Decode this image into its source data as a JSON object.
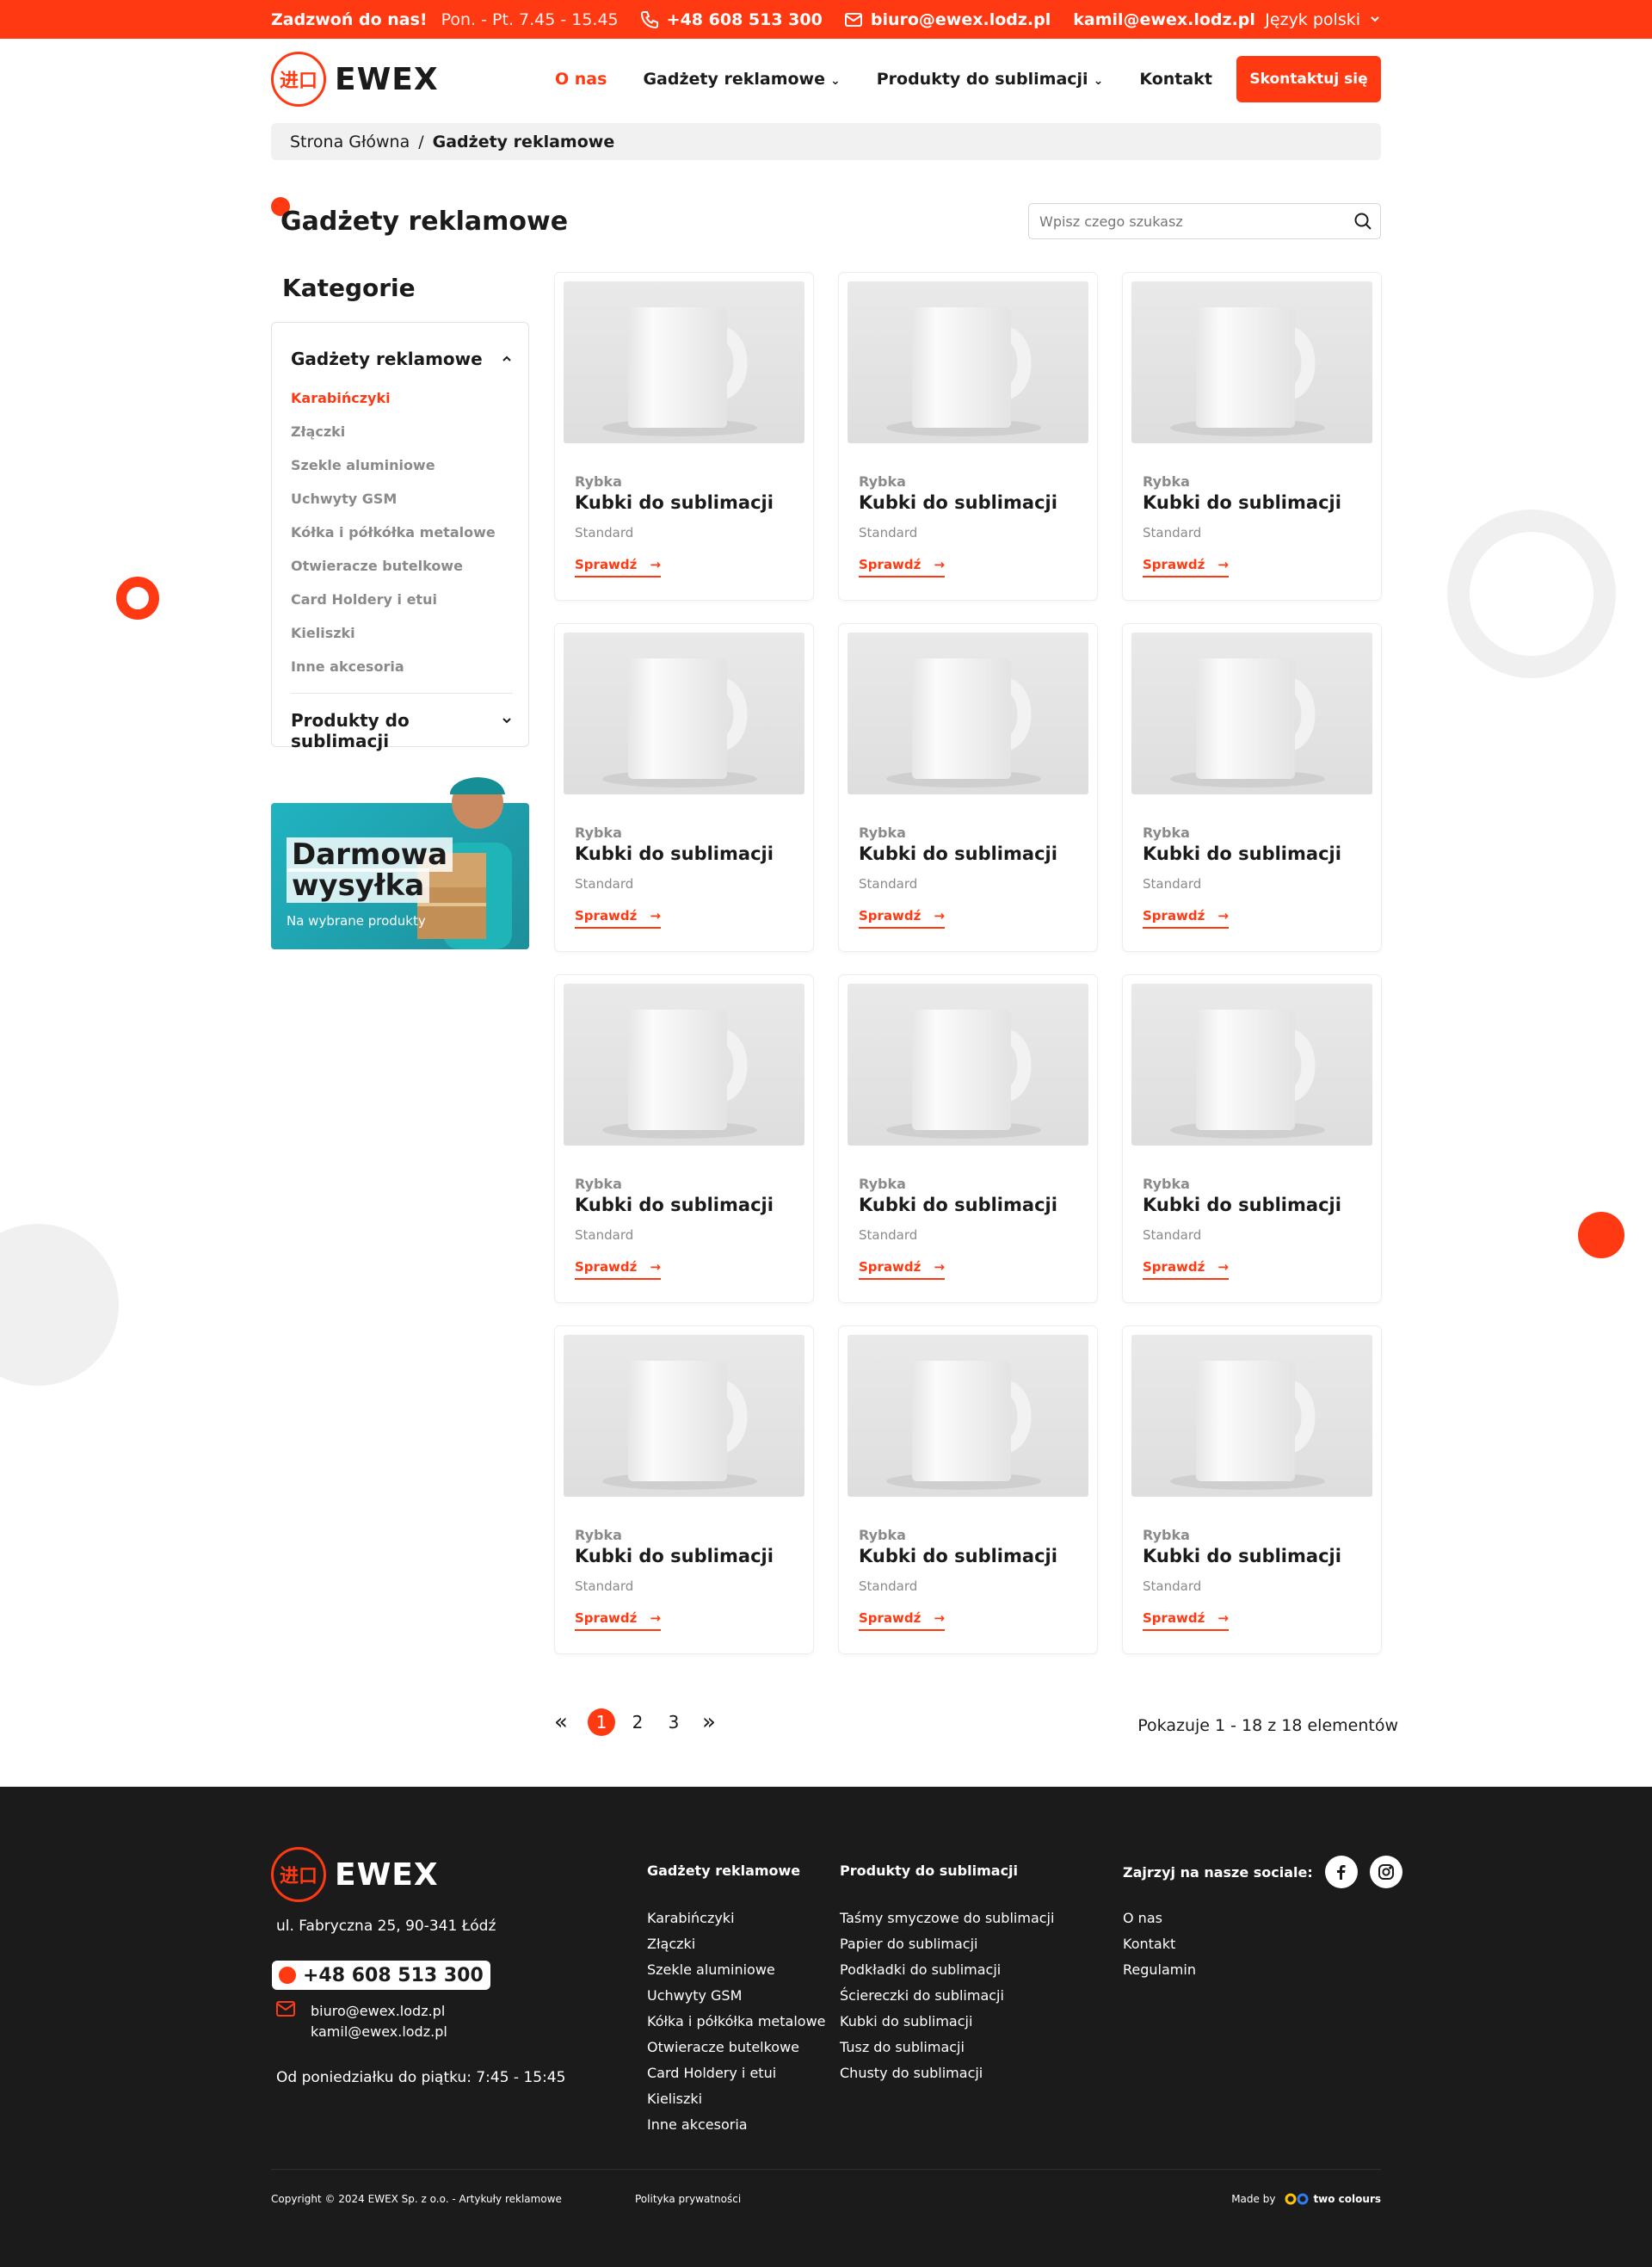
{
  "topbar": {
    "call_label": "Zadzwoń do nas!",
    "hours": "Pon. - Pt. 7.45 - 15.45",
    "phone": "+48 608 513 300",
    "email1": "biuro@ewex.lodz.pl",
    "email2": "kamil@ewex.lodz.pl",
    "language": "Język polski"
  },
  "brand": {
    "name": "EWEX",
    "seal": "进口",
    "accent": "#ff3a12"
  },
  "nav": {
    "items": [
      {
        "label": "O nas"
      },
      {
        "label": "Gadżety reklamowe"
      },
      {
        "label": "Produkty do sublimacji"
      },
      {
        "label": "Kontakt"
      }
    ],
    "cta": "Skontaktuj się"
  },
  "breadcrumb": {
    "home": "Strona Główna",
    "sep": "/",
    "current": "Gadżety reklamowe"
  },
  "page": {
    "title": "Gadżety reklamowe"
  },
  "search": {
    "placeholder": "Wpisz czego szukasz"
  },
  "sidebar": {
    "title": "Kategorie",
    "group1": "Gadżety reklamowe",
    "items": [
      {
        "label": "Karabińczyki"
      },
      {
        "label": "Złączki"
      },
      {
        "label": "Szekle aluminiowe"
      },
      {
        "label": "Uchwyty GSM"
      },
      {
        "label": "Kółka i półkółka metalowe"
      },
      {
        "label": "Otwieracze butelkowe"
      },
      {
        "label": "Card Holdery i etui"
      },
      {
        "label": "Kieliszki"
      },
      {
        "label": "Inne akcesoria"
      }
    ],
    "group2": "Produkty do sublimacji"
  },
  "promo": {
    "line1": "Darmowa",
    "line2": "wysyłka",
    "sub": "Na wybrane produkty"
  },
  "products": [
    {
      "brand": "Rybka",
      "name": "Kubki do sublimacji",
      "variant": "Standard",
      "link": "Sprawdź"
    },
    {
      "brand": "Rybka",
      "name": "Kubki do sublimacji",
      "variant": "Standard",
      "link": "Sprawdź"
    },
    {
      "brand": "Rybka",
      "name": "Kubki do sublimacji",
      "variant": "Standard",
      "link": "Sprawdź"
    },
    {
      "brand": "Rybka",
      "name": "Kubki do sublimacji",
      "variant": "Standard",
      "link": "Sprawdź"
    },
    {
      "brand": "Rybka",
      "name": "Kubki do sublimacji",
      "variant": "Standard",
      "link": "Sprawdź"
    },
    {
      "brand": "Rybka",
      "name": "Kubki do sublimacji",
      "variant": "Standard",
      "link": "Sprawdź"
    },
    {
      "brand": "Rybka",
      "name": "Kubki do sublimacji",
      "variant": "Standard",
      "link": "Sprawdź"
    },
    {
      "brand": "Rybka",
      "name": "Kubki do sublimacji",
      "variant": "Standard",
      "link": "Sprawdź"
    },
    {
      "brand": "Rybka",
      "name": "Kubki do sublimacji",
      "variant": "Standard",
      "link": "Sprawdź"
    },
    {
      "brand": "Rybka",
      "name": "Kubki do sublimacji",
      "variant": "Standard",
      "link": "Sprawdź"
    },
    {
      "brand": "Rybka",
      "name": "Kubki do sublimacji",
      "variant": "Standard",
      "link": "Sprawdź"
    },
    {
      "brand": "Rybka",
      "name": "Kubki do sublimacji",
      "variant": "Standard",
      "link": "Sprawdź"
    }
  ],
  "pagination": {
    "prev": "«",
    "pages": [
      "1",
      "2",
      "3"
    ],
    "current": "1",
    "next": "»",
    "showing": "Pokazuje 1 - 18 z 18 elementów"
  },
  "footer": {
    "address": "ul. Fabryczna 25, 90-341 Łódź",
    "phone": "+48 608 513 300",
    "email1": "biuro@ewex.lodz.pl",
    "email2": "kamil@ewex.lodz.pl",
    "hours": "Od poniedziałku do piątku: 7:45 - 15:45",
    "col1": {
      "title": "Gadżety reklamowe",
      "items": [
        "Karabińczyki",
        "Złączki",
        "Szekle aluminiowe",
        "Uchwyty GSM",
        "Kółka i półkółka metalowe",
        "Otwieracze butelkowe",
        "Card Holdery i etui",
        "Kieliszki",
        "Inne akcesoria"
      ]
    },
    "col2": {
      "title": "Produkty do sublimacji",
      "items": [
        "Taśmy smyczowe do sublimacji",
        "Papier do sublimacji",
        "Podkładki do sublimacji",
        "Ściereczki do sublimacji",
        "Kubki do sublimacji",
        "Tusz do sublimacji",
        "Chusty do sublimacji"
      ]
    },
    "social_label": "Zajrzyj na nasze sociale:",
    "col3": {
      "items": [
        "O nas",
        "Kontakt",
        "Regulamin"
      ]
    },
    "copyright": "Copyright © 2024 EWEX Sp. z o.o. - Artykuły reklamowe",
    "privacy": "Polityka prywatności",
    "made_by": "Made by",
    "agency": "two colours"
  }
}
